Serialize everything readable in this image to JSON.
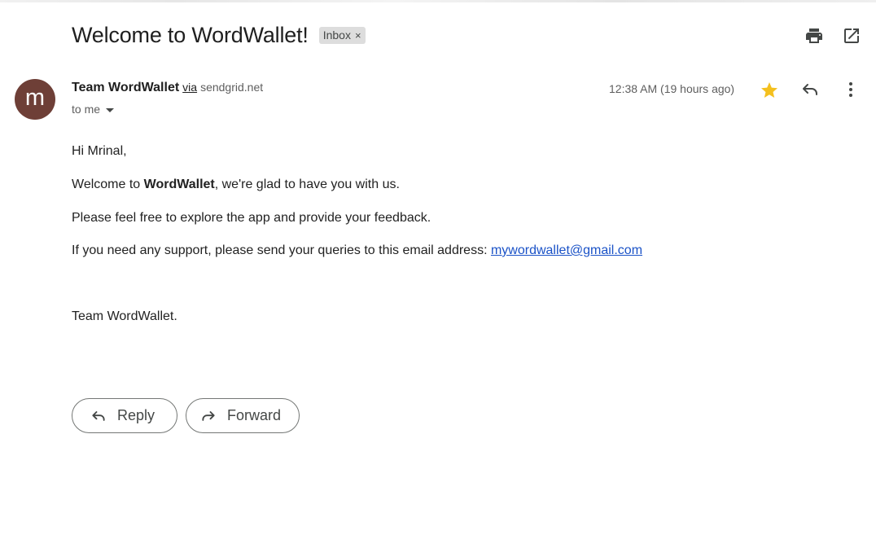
{
  "email": {
    "subject": "Welcome to WordWallet!",
    "label": "Inbox",
    "label_remove": "×",
    "sender": {
      "avatar_letter": "m",
      "avatar_color": "#6e3f37",
      "name": "Team WordWallet",
      "via": "via",
      "via_domain": "sendgrid.net",
      "recipient": "to me"
    },
    "timestamp": "12:38 AM (19 hours ago)",
    "starred": true,
    "body": {
      "greeting": "Hi Mrinal,",
      "welcome_prefix": "Welcome to ",
      "welcome_brand": "WordWallet",
      "welcome_suffix": ", we're glad to have you with us.",
      "explore": "Please feel free to explore the app and provide your feedback.",
      "support_prefix": "If you need any support, please send your queries to this email address: ",
      "support_email": "mywordwallet@gmail.com",
      "signoff": "Team WordWallet."
    }
  },
  "actions": {
    "reply_label": "Reply",
    "forward_label": "Forward"
  },
  "icons": {
    "print": "print-icon",
    "popout": "open-in-new-window-icon",
    "star": "star-icon",
    "reply": "reply-icon",
    "more": "more-vert-icon",
    "forward": "forward-icon",
    "dropdown": "chevron-down-icon"
  },
  "colors": {
    "star": "#f4c01e",
    "link": "#1a52c7",
    "label_chip_bg": "#dddddd"
  }
}
